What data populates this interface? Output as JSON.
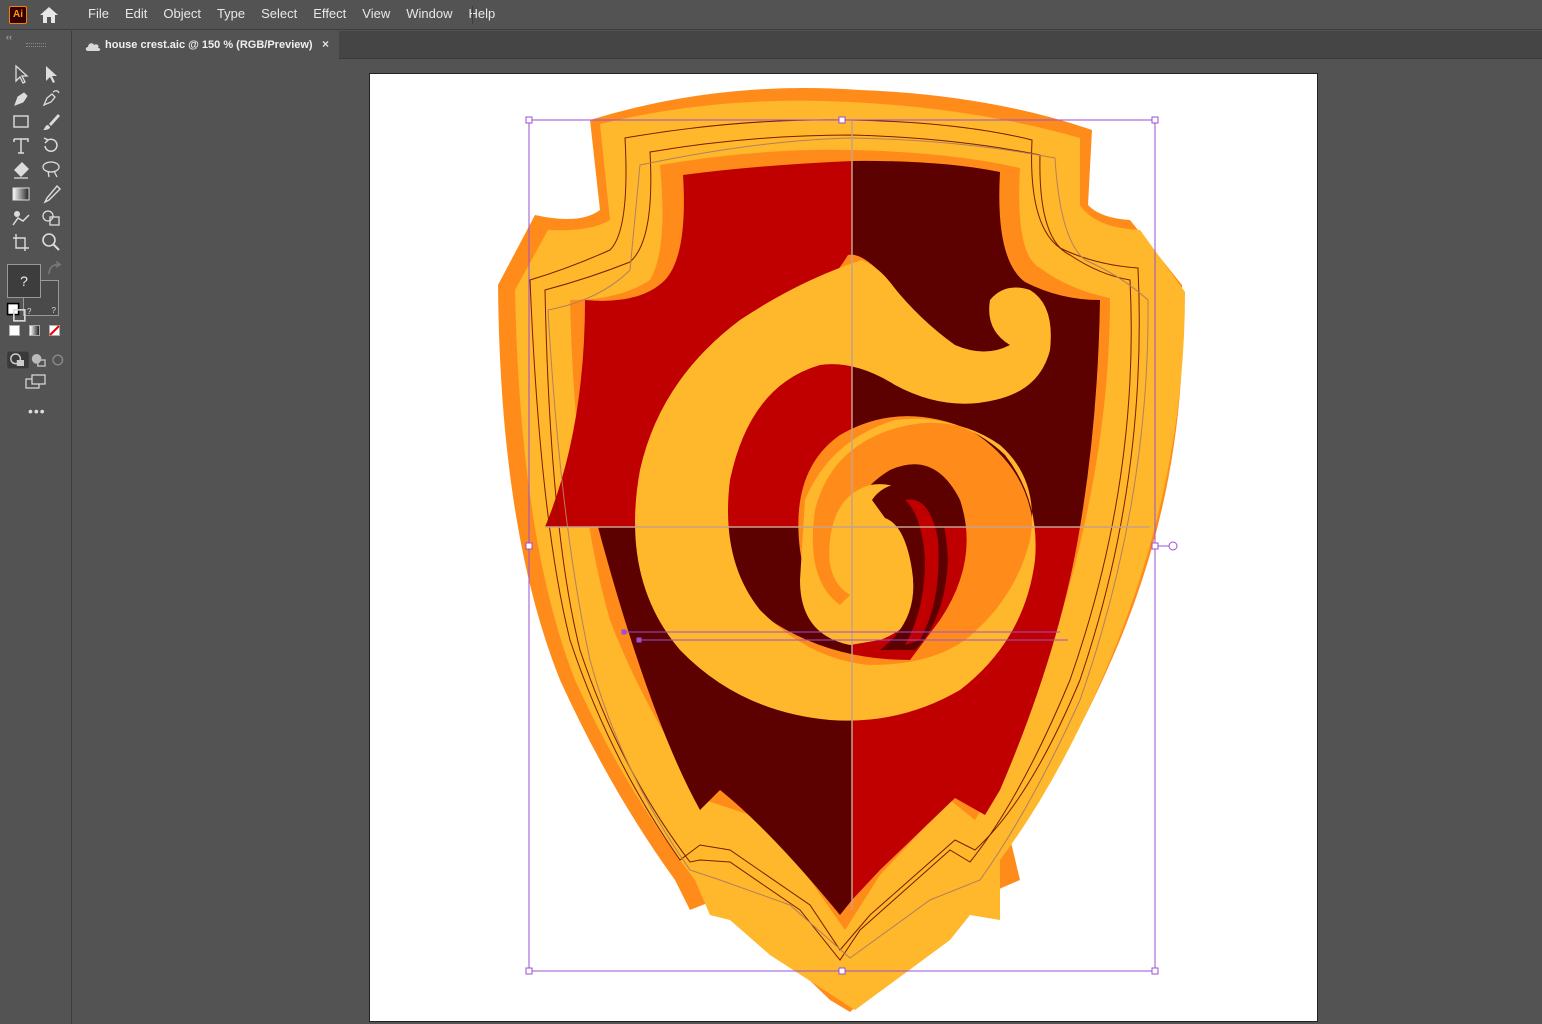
{
  "app": {
    "logo_text": "Ai",
    "menu": [
      "File",
      "Edit",
      "Object",
      "Type",
      "Select",
      "Effect",
      "View",
      "Window",
      "Help"
    ]
  },
  "document": {
    "tab_title": "house crest.aic @ 150 % (RGB/Preview)",
    "close_glyph": "×"
  },
  "toolbar": {
    "collapse_glyph": "‹‹",
    "fill_stroke_unknown": "?",
    "more_glyph": "•••",
    "tools": [
      "selection-tool",
      "direct-selection-tool",
      "pen-tool",
      "curvature-tool",
      "rectangle-tool",
      "paintbrush-tool",
      "type-tool",
      "rotate-tool",
      "eraser-tool",
      "lasso-tool",
      "gradient-tool",
      "eyedropper-tool",
      "puppet-warp-tool",
      "shape-builder-tool",
      "artboard-tool",
      "zoom-tool"
    ]
  },
  "artwork": {
    "subject": "house crest shield",
    "colors": {
      "outer_orange": "#ff8c1a",
      "gold": "#ffb72b",
      "red": "#c00000",
      "dark_red": "#5c0000",
      "selection": "#9a4fd6"
    }
  }
}
